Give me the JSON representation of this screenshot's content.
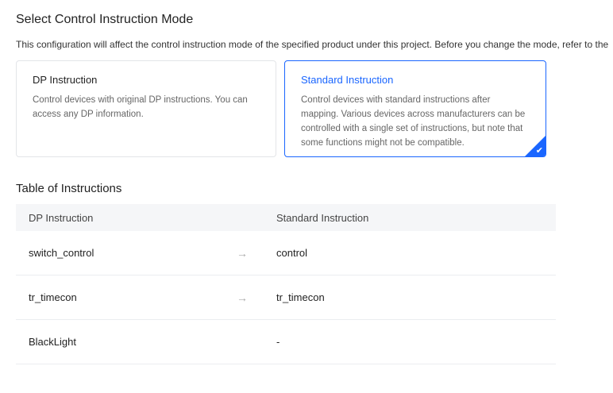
{
  "title": "Select Control Instruction Mode",
  "description": "This configuration will affect the control instruction mode of the specified product under this project. Before you change the mode, refer to the",
  "cards": [
    {
      "title": "DP Instruction",
      "text": "Control devices with original DP instructions. You can access any DP information.",
      "selected": false
    },
    {
      "title": "Standard Instruction",
      "text": "Control devices with standard instructions after mapping. Various devices across manufacturers can be controlled with a single set of instructions, but note that some functions might not be compatible.",
      "selected": true
    }
  ],
  "table": {
    "title": "Table of Instructions",
    "headers": [
      "DP Instruction",
      "Standard Instruction"
    ],
    "rows": [
      {
        "dp": "switch_control",
        "arrow": "→",
        "std": "control"
      },
      {
        "dp": "tr_timecon",
        "arrow": "→",
        "std": "tr_timecon"
      },
      {
        "dp": "BlackLight",
        "arrow": "",
        "std": "-"
      }
    ]
  },
  "colors": {
    "accent": "#1a66ff"
  }
}
